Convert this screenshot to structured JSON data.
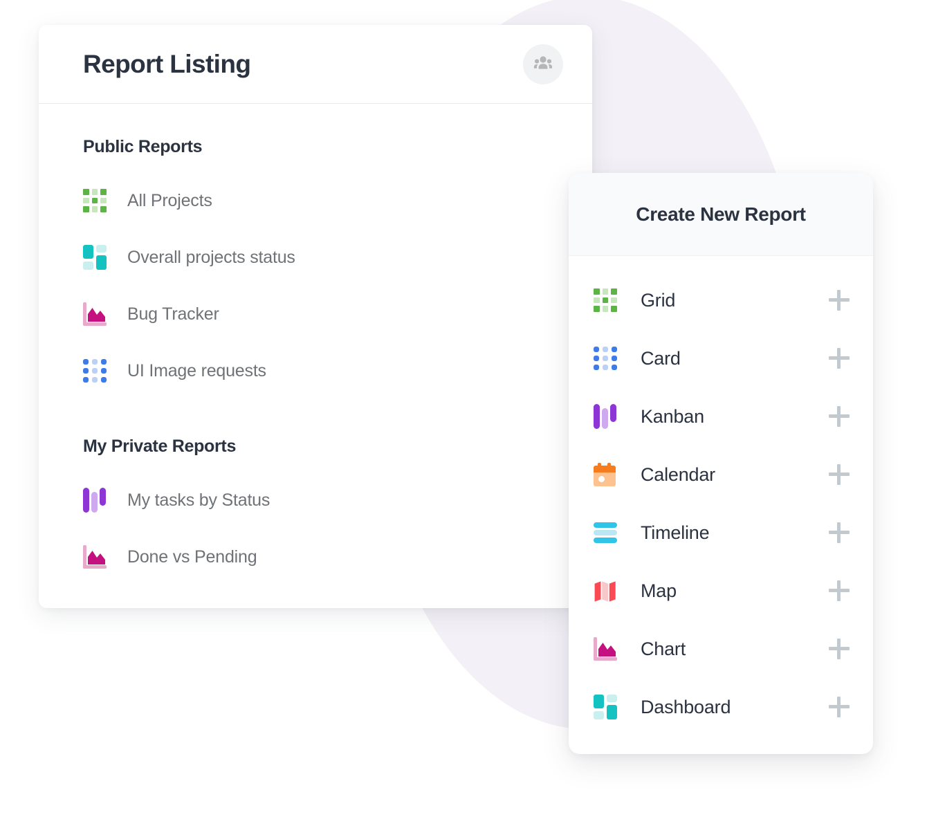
{
  "colors": {
    "page_background": "#ffffff",
    "decorative_blob": "#f3f1f7",
    "card_background": "#ffffff",
    "panel_header_background": "#f9fafb",
    "heading_text": "#2b3240",
    "item_text": "#6f7276",
    "menu_item_text": "#2b3240",
    "plus_icon": "#c2c9cf",
    "people_icon": "#b4b6b9",
    "people_icon_background": "#f1f2f4",
    "divider": "#e8eaed",
    "green_dark": "#5cb447",
    "green_light": "#c8e6bd",
    "blue_dark": "#3d7ce8",
    "blue_light": "#bad0f7",
    "teal_dark": "#15c2c2",
    "teal_light": "#c9f0ee",
    "purple_dark": "#8e35d6",
    "purple_light": "#cfa9ef",
    "magenta_dark": "#c5117f",
    "magenta_light": "#e9a9ca",
    "orange_dark": "#f57d20",
    "orange_light": "#fcc390",
    "cyan_dark": "#2fc4e8",
    "cyan_light": "#bbe7f5",
    "red_dark": "#fb4a53",
    "red_light": "#f7c8ca"
  },
  "report_card": {
    "header": {
      "title": "Report Listing",
      "people_button_label": "people-icon"
    },
    "sections": [
      {
        "heading": "Public Reports",
        "items": [
          {
            "label": "All Projects",
            "icon": "grid-icon"
          },
          {
            "label": "Overall projects status",
            "icon": "dashboard-icon"
          },
          {
            "label": "Bug Tracker",
            "icon": "chart-icon"
          },
          {
            "label": "UI Image requests",
            "icon": "card-icon"
          }
        ]
      },
      {
        "heading": "My Private Reports",
        "items": [
          {
            "label": "My tasks by Status",
            "icon": "kanban-icon"
          },
          {
            "label": "Done vs Pending",
            "icon": "chart-icon"
          }
        ]
      }
    ]
  },
  "create_panel": {
    "title": "Create New Report",
    "add_icon": "plus-icon",
    "items": [
      {
        "label": "Grid",
        "icon": "grid-icon"
      },
      {
        "label": "Card",
        "icon": "card-icon"
      },
      {
        "label": "Kanban",
        "icon": "kanban-icon"
      },
      {
        "label": "Calendar",
        "icon": "calendar-icon"
      },
      {
        "label": "Timeline",
        "icon": "timeline-icon"
      },
      {
        "label": "Map",
        "icon": "map-icon"
      },
      {
        "label": "Chart",
        "icon": "chart-icon"
      },
      {
        "label": "Dashboard",
        "icon": "dashboard-icon"
      }
    ]
  }
}
